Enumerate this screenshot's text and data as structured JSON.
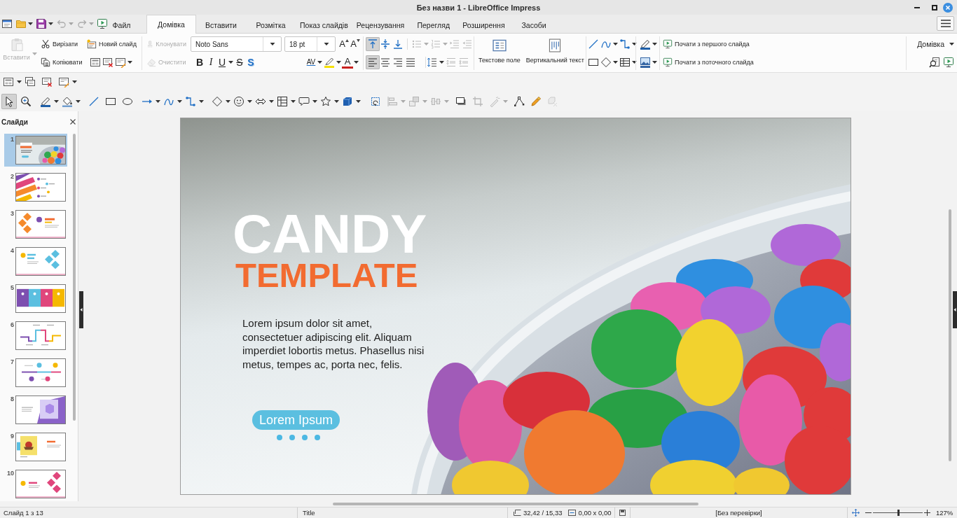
{
  "window": {
    "title": "Без назви 1 - LibreOffice Impress"
  },
  "quick_toolbar": [
    {
      "kind": "new",
      "dropdown": false,
      "disabled": false
    },
    {
      "kind": "open",
      "dropdown": true,
      "disabled": false
    },
    {
      "kind": "save",
      "dropdown": true,
      "disabled": false
    },
    {
      "kind": "undo",
      "dropdown": true,
      "disabled": true
    },
    {
      "kind": "redo",
      "dropdown": true,
      "disabled": true
    },
    {
      "kind": "slideshow",
      "dropdown": false,
      "disabled": false
    }
  ],
  "tabs": [
    {
      "label": "Файл",
      "selected": false
    },
    {
      "label": "Домівка",
      "selected": true
    },
    {
      "label": "Вставити",
      "selected": false
    },
    {
      "label": "Розмітка",
      "selected": false
    },
    {
      "label": "Показ слайдів",
      "selected": false
    },
    {
      "label": "Рецензування",
      "selected": false
    },
    {
      "label": "Перегляд",
      "selected": false
    },
    {
      "label": "Розширення",
      "selected": false
    },
    {
      "label": "Засоби",
      "selected": false
    }
  ],
  "ribbon": {
    "paste": {
      "label": "Вставити",
      "disabled": true,
      "dropdown": true
    },
    "clipboard": [
      {
        "kind": "cut",
        "label": "Вирізати",
        "disabled": false
      },
      {
        "kind": "copy",
        "label": "Копіювати",
        "disabled": false
      }
    ],
    "new_slide": {
      "label": "Новий слайд"
    },
    "slide_tools": [
      {
        "kind": "slide-layout",
        "dropdown": false,
        "disabled": false
      },
      {
        "kind": "delete-slide",
        "dropdown": false,
        "disabled": false
      },
      {
        "kind": "slide-edit",
        "dropdown": true,
        "disabled": false
      }
    ],
    "edit_tools": [
      {
        "kind": "clone",
        "label": "Клонувати",
        "disabled": true
      },
      {
        "kind": "clear",
        "label": "Очистити",
        "disabled": true
      }
    ],
    "font_name": "Noto Sans",
    "font_size": "18 pt",
    "size_tools": [
      {
        "kind": "grow",
        "label": "A",
        "dropdown": false,
        "disabled": false
      },
      {
        "kind": "shrink",
        "label": "A",
        "dropdown": false,
        "disabled": false
      }
    ],
    "format_tools": [
      {
        "kind": "bold",
        "label": "B",
        "dropdown": false,
        "disabled": false
      },
      {
        "kind": "italic",
        "label": "I",
        "dropdown": false,
        "disabled": false
      },
      {
        "kind": "underline",
        "label": "U",
        "dropdown": true,
        "disabled": false
      },
      {
        "kind": "strike",
        "label": "S",
        "dropdown": false,
        "disabled": false
      },
      {
        "kind": "shadow",
        "label": "S",
        "dropdown": false,
        "disabled": false
      }
    ],
    "color_tools": [
      {
        "kind": "spacing",
        "label": "AV",
        "dropdown": true,
        "disabled": false
      },
      {
        "kind": "highlight",
        "dropdown": true,
        "disabled": false
      },
      {
        "kind": "font-color",
        "label": "A",
        "dropdown": true,
        "disabled": false
      }
    ],
    "valign_tools": [
      {
        "kind": "valign-top",
        "dropdown": false,
        "disabled": false,
        "selected": true
      },
      {
        "kind": "valign-middle",
        "dropdown": false,
        "disabled": false,
        "selected": false
      },
      {
        "kind": "valign-bottom",
        "dropdown": false,
        "disabled": false,
        "selected": false
      }
    ],
    "list_tools": [
      {
        "kind": "bullets",
        "dropdown": true,
        "disabled": true
      },
      {
        "kind": "numbering",
        "dropdown": true,
        "disabled": true
      },
      {
        "kind": "indent",
        "dropdown": false,
        "disabled": true
      },
      {
        "kind": "outdent",
        "dropdown": false,
        "disabled": true
      }
    ],
    "align_tools": [
      {
        "kind": "align-left",
        "dropdown": false,
        "disabled": false,
        "selected": true
      },
      {
        "kind": "align-center",
        "dropdown": false,
        "disabled": false,
        "selected": false
      },
      {
        "kind": "align-right",
        "dropdown": false,
        "disabled": false,
        "selected": false
      },
      {
        "kind": "justify",
        "dropdown": false,
        "disabled": false,
        "selected": false
      }
    ],
    "spacing_tools": [
      {
        "kind": "line-spacing",
        "dropdown": true,
        "disabled": false
      },
      {
        "kind": "para-inc",
        "dropdown": false,
        "disabled": true
      },
      {
        "kind": "para-dec",
        "dropdown": false,
        "disabled": true
      }
    ],
    "insert_tools": [
      {
        "kind": "text-box",
        "label": "Текстове поле"
      },
      {
        "kind": "vertical-text",
        "label": "Вертикальний текст"
      }
    ],
    "shape_rows": [
      [
        {
          "kind": "line",
          "dropdown": false,
          "disabled": false
        },
        {
          "kind": "curve",
          "dropdown": true,
          "disabled": false
        },
        {
          "kind": "connector",
          "dropdown": true,
          "disabled": false
        }
      ],
      [
        {
          "kind": "rect",
          "dropdown": false,
          "disabled": false
        },
        {
          "kind": "diamond",
          "dropdown": true,
          "disabled": false
        },
        {
          "kind": "table",
          "dropdown": true,
          "disabled": false
        }
      ]
    ],
    "style_rows": [
      [
        {
          "kind": "line-color",
          "dropdown": true,
          "disabled": false
        }
      ],
      [
        {
          "kind": "area-style",
          "dropdown": true,
          "disabled": false
        }
      ]
    ],
    "slideshow": [
      {
        "label": "Почати з першого слайда"
      },
      {
        "label": "Почати з поточного слайда"
      }
    ],
    "context": {
      "label": "Домівка"
    },
    "side_tools": [
      {
        "kind": "find",
        "dropdown": false,
        "disabled": false
      },
      {
        "kind": "slideshow",
        "dropdown": false,
        "disabled": false
      }
    ]
  },
  "slide_toolbar": [
    {
      "kind": "slide-layout",
      "dropdown": true,
      "disabled": false
    },
    {
      "kind": "duplicate-slide",
      "dropdown": false,
      "disabled": false
    },
    {
      "kind": "delete-slide",
      "dropdown": false,
      "disabled": false
    },
    {
      "kind": "slide-edit",
      "dropdown": true,
      "disabled": false
    }
  ],
  "drawing_toolbar": [
    {
      "kind": "pointer",
      "dropdown": false,
      "disabled": false,
      "selected": true
    },
    {
      "kind": "zoom",
      "dropdown": false,
      "disabled": false,
      "selected": false
    },
    {
      "kind": "line-color",
      "dropdown": true,
      "disabled": false,
      "selected": false
    },
    {
      "kind": "fill-color",
      "dropdown": true,
      "disabled": false,
      "selected": false
    },
    {
      "kind": "line",
      "dropdown": false,
      "disabled": false,
      "selected": false
    },
    {
      "kind": "rect",
      "dropdown": false,
      "disabled": false,
      "selected": false
    },
    {
      "kind": "ellipse",
      "dropdown": false,
      "disabled": false,
      "selected": false
    },
    {
      "kind": "arrow",
      "dropdown": true,
      "disabled": false,
      "selected": false
    },
    {
      "kind": "curve",
      "dropdown": true,
      "disabled": false,
      "selected": false
    },
    {
      "kind": "connector",
      "dropdown": true,
      "disabled": false,
      "selected": false
    },
    {
      "kind": "diamond",
      "dropdown": true,
      "disabled": false,
      "selected": false
    },
    {
      "kind": "smiley",
      "dropdown": true,
      "disabled": false,
      "selected": false
    },
    {
      "kind": "double-arrow",
      "dropdown": true,
      "disabled": false,
      "selected": false
    },
    {
      "kind": "flowchart",
      "dropdown": true,
      "disabled": false,
      "selected": false
    },
    {
      "kind": "callout",
      "dropdown": true,
      "disabled": false,
      "selected": false
    },
    {
      "kind": "star",
      "dropdown": true,
      "disabled": false,
      "selected": false
    },
    {
      "kind": "cube",
      "dropdown": true,
      "disabled": false,
      "selected": false
    },
    {
      "kind": "rotate",
      "dropdown": false,
      "disabled": false,
      "selected": false
    },
    {
      "kind": "align-objects",
      "dropdown": true,
      "disabled": true,
      "selected": false
    },
    {
      "kind": "arrange",
      "dropdown": true,
      "disabled": true,
      "selected": false
    },
    {
      "kind": "distribute",
      "dropdown": true,
      "disabled": true,
      "selected": false
    },
    {
      "kind": "shadow-obj",
      "dropdown": false,
      "disabled": false,
      "selected": false
    },
    {
      "kind": "crop",
      "dropdown": false,
      "disabled": true,
      "selected": false
    },
    {
      "kind": "filter",
      "dropdown": true,
      "disabled": true,
      "selected": false
    },
    {
      "kind": "points",
      "dropdown": false,
      "disabled": false,
      "selected": false
    },
    {
      "kind": "glue",
      "dropdown": false,
      "disabled": false,
      "selected": false
    },
    {
      "kind": "extrusion",
      "dropdown": false,
      "disabled": true,
      "selected": false
    }
  ],
  "slides_panel": {
    "title": "Слайди",
    "slides": [
      {
        "number": "1",
        "kind": "photo",
        "selected": true
      },
      {
        "number": "2",
        "kind": "stripes",
        "selected": false
      },
      {
        "number": "3",
        "kind": "diamonds-left",
        "selected": false
      },
      {
        "number": "4",
        "kind": "diamonds-right",
        "selected": false
      },
      {
        "number": "5",
        "kind": "columns",
        "selected": false
      },
      {
        "number": "6",
        "kind": "steps",
        "selected": false
      },
      {
        "number": "7",
        "kind": "timeline",
        "selected": false
      },
      {
        "number": "8",
        "kind": "cube",
        "selected": false
      },
      {
        "number": "9",
        "kind": "poster",
        "selected": false
      },
      {
        "number": "10",
        "kind": "diamonds-pink",
        "selected": false
      }
    ]
  },
  "slide": {
    "title": "CANDY",
    "subtitle": "TEMPLATE",
    "body": "Lorem ipsum dolor sit amet,\nconsectetuer adipiscing elit. Aliquam\nimperdiet lobortis metus. Phasellus nisi\nmetus, tempes ac, porta nec, felis.",
    "button": "Lorem Ipsum"
  },
  "status_bar": {
    "slide": "Слайд 1 з 13",
    "layout": "Title",
    "position": "32,42 / 15,33",
    "size": "0,00 x 0,00",
    "signature": "[Без перевірки]",
    "zoom": {
      "level": 0.52,
      "label": "127%"
    }
  }
}
